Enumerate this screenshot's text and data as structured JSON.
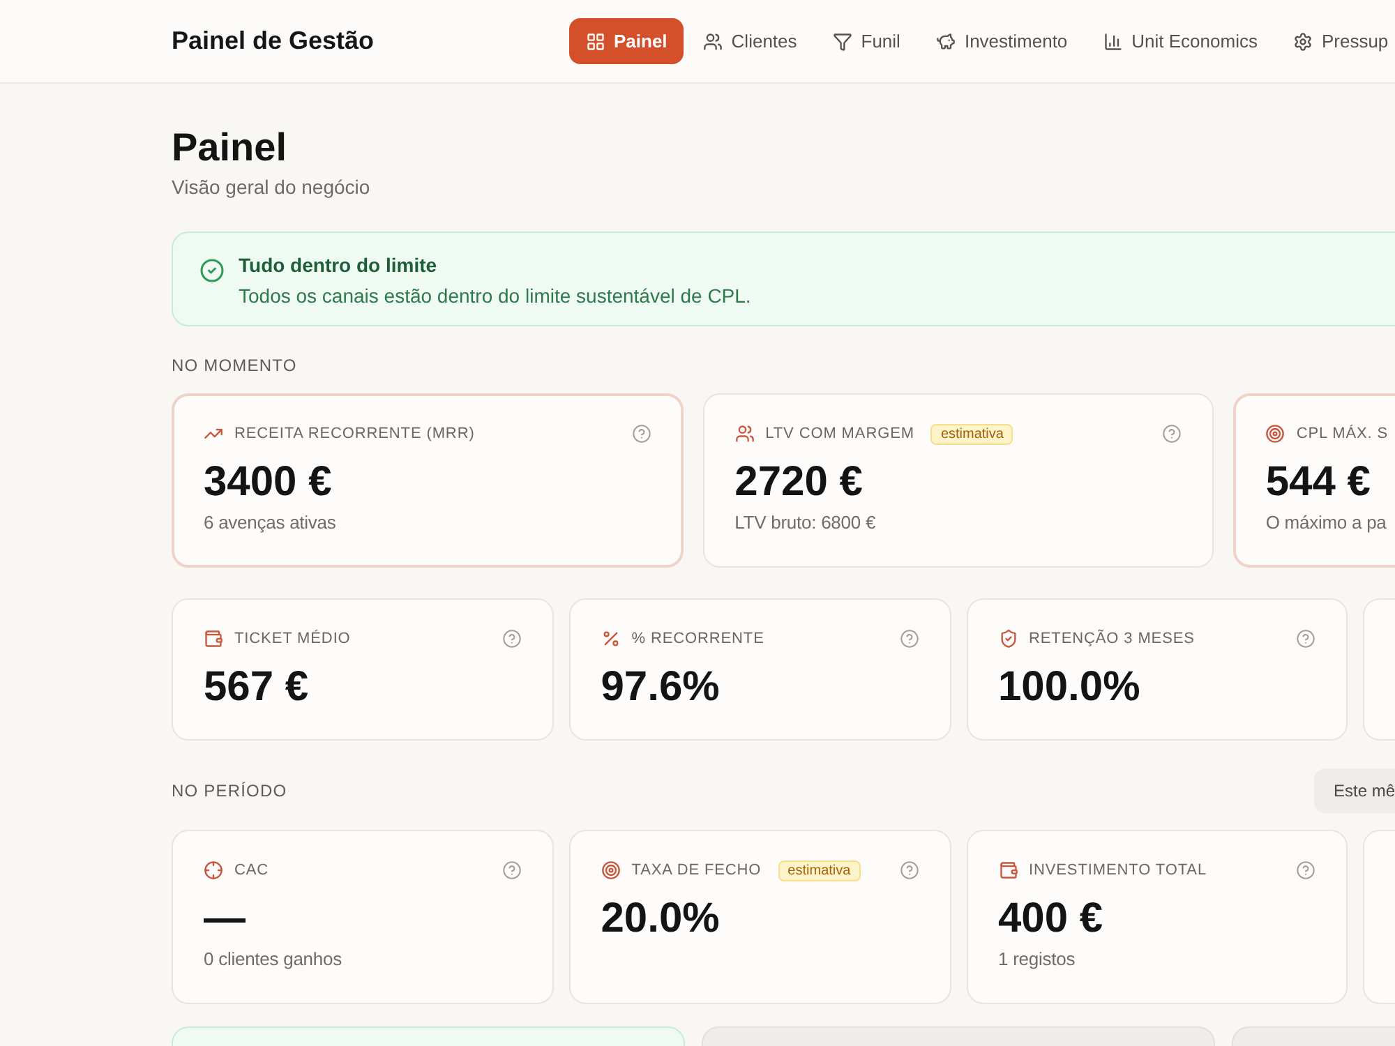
{
  "header": {
    "title": "Painel de Gestão",
    "nav": [
      {
        "label": "Painel",
        "selected": true
      },
      {
        "label": "Clientes",
        "selected": false
      },
      {
        "label": "Funil",
        "selected": false
      },
      {
        "label": "Investimento",
        "selected": false
      },
      {
        "label": "Unit Economics",
        "selected": false
      },
      {
        "label": "Pressup",
        "selected": false
      }
    ]
  },
  "page": {
    "title": "Painel",
    "subtitle": "Visão geral do negócio"
  },
  "alert": {
    "title": "Tudo dentro do limite",
    "message": "Todos os canais estão dentro do limite sustentável de CPL."
  },
  "sections": [
    {
      "title": "NO MOMENTO",
      "rows": [
        [
          {
            "kind": "stat",
            "label": "RECEITA RECORRENTE (MRR)",
            "value": "3400 €",
            "note": "6 avenças ativas",
            "highlighted": true,
            "help": true
          },
          {
            "kind": "stat",
            "label": "LTV COM MARGEM",
            "badge": "estimativa",
            "value": "2720 €",
            "note": "LTV bruto: 6800 €",
            "highlighted": false,
            "help": true
          },
          {
            "kind": "stat",
            "label": "CPL MÁX. S",
            "value": "544 €",
            "note": "O máximo a pa",
            "highlighted": true,
            "help": false
          }
        ],
        [
          {
            "kind": "stat",
            "label": "TICKET MÉDIO",
            "value": "567 €",
            "highlighted": false,
            "help": true
          },
          {
            "kind": "stat",
            "label": "% RECORRENTE",
            "value": "97.6%",
            "highlighted": false,
            "help": true
          },
          {
            "kind": "stat",
            "label": "RETENÇÃO 3 MESES",
            "value": "100.0%",
            "highlighted": false,
            "help": true
          },
          {
            "kind": "blank"
          }
        ]
      ]
    },
    {
      "title": "NO PERÍODO",
      "period": "Este mê",
      "rows": [
        [
          {
            "kind": "stat",
            "label": "CAC",
            "value": "—",
            "note": "0 clientes ganhos",
            "highlighted": false,
            "help": true
          },
          {
            "kind": "stat",
            "label": "TAXA DE FECHO",
            "badge": "estimativa",
            "value": "20.0%",
            "highlighted": false,
            "help": true
          },
          {
            "kind": "stat",
            "label": "INVESTIMENTO TOTAL",
            "value": "400 €",
            "note": "1 registos",
            "highlighted": false,
            "help": true
          },
          {
            "kind": "blank"
          }
        ]
      ]
    }
  ],
  "lower_panels": [
    {
      "kind": "success"
    },
    {
      "kind": "plain"
    },
    {
      "kind": "plain"
    }
  ]
}
